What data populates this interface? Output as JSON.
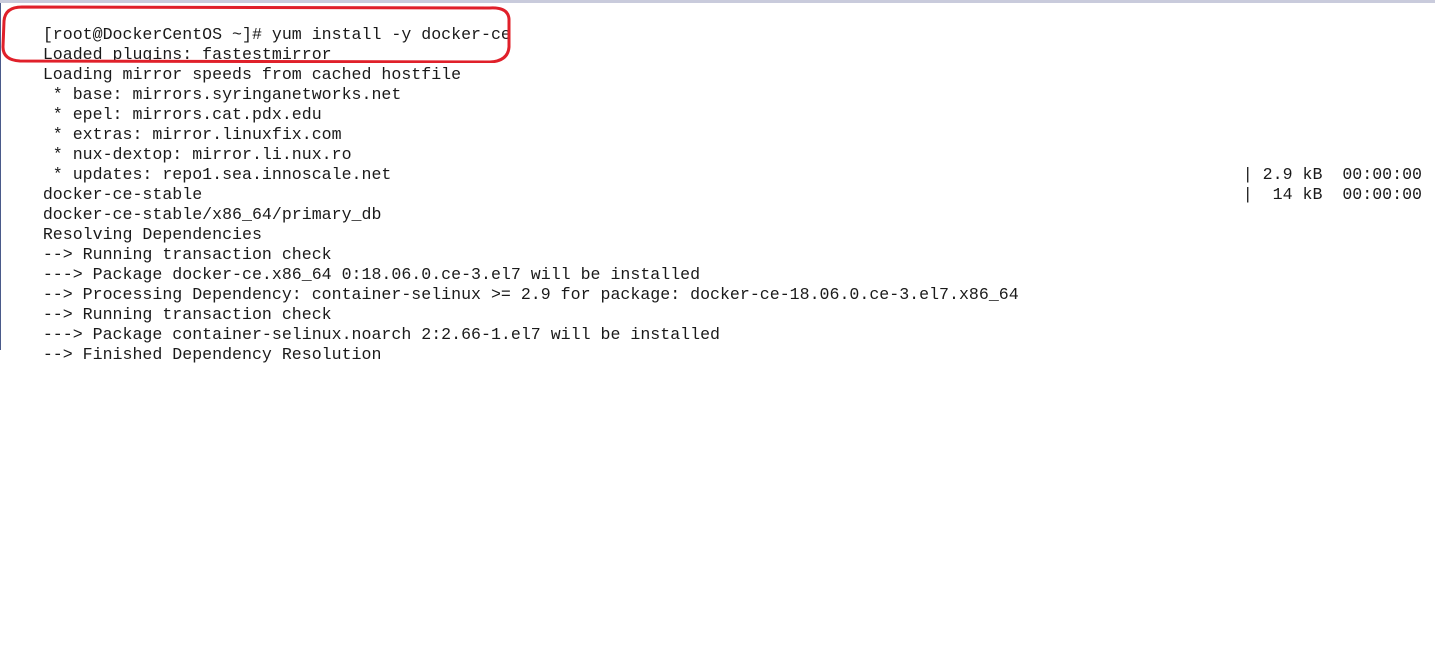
{
  "terminal": {
    "lines": [
      {
        "text": "[root@DockerCentOS ~]# yum install -y docker-ce",
        "right": ""
      },
      {
        "text": "Loaded plugins: fastestmirror",
        "right": ""
      },
      {
        "text": "Loading mirror speeds from cached hostfile",
        "right": ""
      },
      {
        "text": " * base: mirrors.syringanetworks.net",
        "right": ""
      },
      {
        "text": " * epel: mirrors.cat.pdx.edu",
        "right": ""
      },
      {
        "text": " * extras: mirror.linuxfix.com",
        "right": ""
      },
      {
        "text": " * nux-dextop: mirror.li.nux.ro",
        "right": ""
      },
      {
        "text": " * updates: repo1.sea.innoscale.net",
        "right": ""
      },
      {
        "text": "docker-ce-stable",
        "right": "| 2.9 kB  00:00:00"
      },
      {
        "text": "docker-ce-stable/x86_64/primary_db",
        "right": "|  14 kB  00:00:00"
      },
      {
        "text": "Resolving Dependencies",
        "right": ""
      },
      {
        "text": "--> Running transaction check",
        "right": ""
      },
      {
        "text": "---> Package docker-ce.x86_64 0:18.06.0.ce-3.el7 will be installed",
        "right": ""
      },
      {
        "text": "--> Processing Dependency: container-selinux >= 2.9 for package: docker-ce-18.06.0.ce-3.el7.x86_64",
        "right": ""
      },
      {
        "text": "--> Running transaction check",
        "right": ""
      },
      {
        "text": "---> Package container-selinux.noarch 2:2.66-1.el7 will be installed",
        "right": ""
      },
      {
        "text": "--> Finished Dependency Resolution",
        "right": ""
      }
    ]
  },
  "colors": {
    "background": "#ffffff",
    "text": "#1a1a1a",
    "annotation": "#e0202a"
  }
}
